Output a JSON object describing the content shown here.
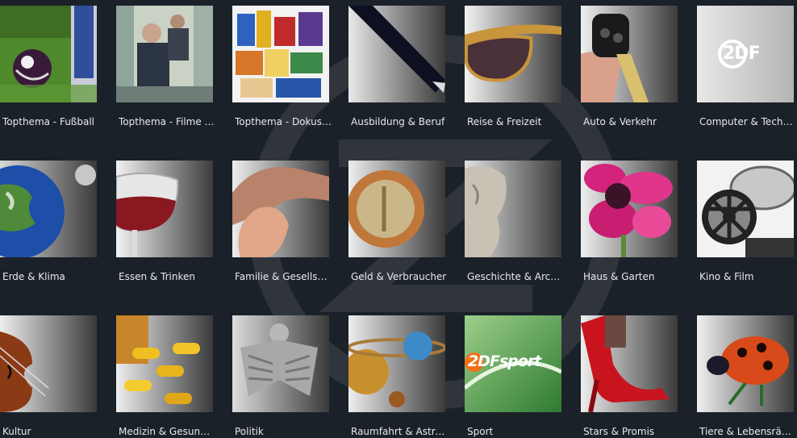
{
  "app": {
    "watermark_icon": "zdf-logo-watermark"
  },
  "tiles": [
    {
      "label": "Topthema - Fußball",
      "icon": "soccer-ball-image"
    },
    {
      "label": "Topthema - Filme u...",
      "icon": "film-still-image"
    },
    {
      "label": "Topthema - Dokus ...",
      "icon": "groceries-image"
    },
    {
      "label": "Ausbildung & Beruf",
      "icon": "pen-image"
    },
    {
      "label": "Reise & Freizeit",
      "icon": "sunglasses-image"
    },
    {
      "label": "Auto & Verkehr",
      "icon": "car-key-image"
    },
    {
      "label": "Computer & Techn...",
      "icon": "zdf-logo-image",
      "logo_text": "2DF"
    },
    {
      "label": "Erde & Klima",
      "icon": "earth-globe-image"
    },
    {
      "label": "Essen & Trinken",
      "icon": "wine-glass-image"
    },
    {
      "label": "Familie & Gesellsch...",
      "icon": "hands-image"
    },
    {
      "label": "Geld & Verbraucher",
      "icon": "euro-coin-image"
    },
    {
      "label": "Geschichte & Arch...",
      "icon": "statue-bust-image"
    },
    {
      "label": "Haus & Garten",
      "icon": "flower-image"
    },
    {
      "label": "Kino & Film",
      "icon": "film-reel-image"
    },
    {
      "label": "Kultur",
      "icon": "violin-image"
    },
    {
      "label": "Medizin & Gesund...",
      "icon": "pills-image"
    },
    {
      "label": "Politik",
      "icon": "federal-eagle-image"
    },
    {
      "label": "Raumfahrt & Astro...",
      "icon": "planets-image"
    },
    {
      "label": "Sport",
      "icon": "zdf-sport-logo-image",
      "logo_text": "2DFsport"
    },
    {
      "label": "Stars & Promis",
      "icon": "high-heel-shoe-image"
    },
    {
      "label": "Tiere & Lebensräu...",
      "icon": "ladybug-image"
    }
  ]
}
